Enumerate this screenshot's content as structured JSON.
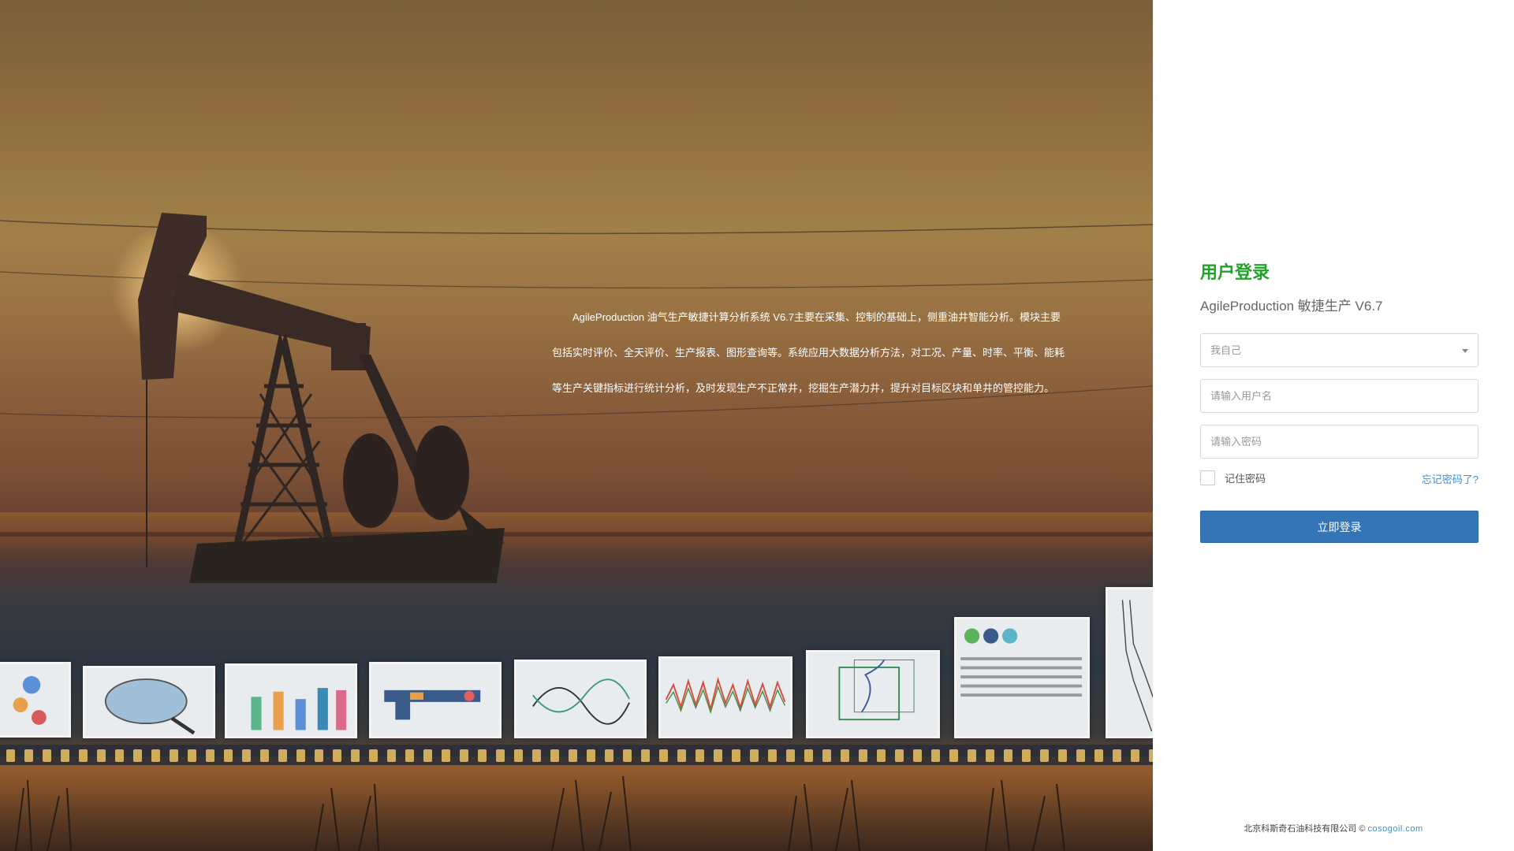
{
  "hero": {
    "description": "AgileProduction 油气生产敏捷计算分析系统 V6.7主要在采集、控制的基础上，侧重油井智能分析。模块主要包括实时评价、全天评价、生产报表、图形查询等。系统应用大数据分析方法，对工况、产量、时率、平衡、能耗等生产关键指标进行统计分析，及时发现生产不正常井，挖掘生产潜力井，提升对目标区块和单井的管控能力。"
  },
  "login": {
    "title": "用户登录",
    "subtitle": "AgileProduction 敏捷生产 V6.7",
    "org_select": {
      "selected": "我自己"
    },
    "username": {
      "placeholder": "请输入用户名",
      "value": ""
    },
    "password": {
      "placeholder": "请输入密码",
      "value": ""
    },
    "remember_label": "记住密码",
    "forgot_label": "忘记密码了?",
    "submit_label": "立即登录"
  },
  "footer": {
    "company": "北京科斯奇石油科技有限公司 ©",
    "link": "cosogoil.com"
  },
  "colors": {
    "accent_green": "#22a228",
    "button_blue": "#3475b8",
    "link_blue": "#3b8fd6"
  }
}
